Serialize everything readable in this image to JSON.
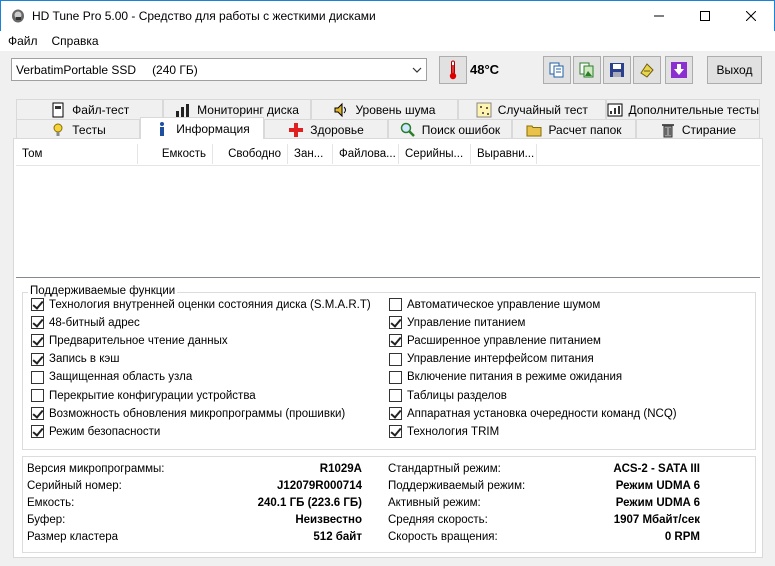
{
  "window": {
    "title": "HD Tune Pro 5.00 - Средство для работы с жесткими дисками"
  },
  "menu": {
    "items": [
      "Файл",
      "Справка"
    ]
  },
  "toolbar": {
    "drive_name": "VerbatimPortable SSD",
    "drive_size": "(240 ГБ)",
    "temperature": "48°C",
    "exit_label": "Выход",
    "icons": [
      "thermometer-icon",
      "copy-text-icon",
      "copy-image-icon",
      "save-icon",
      "options-icon",
      "download-icon"
    ]
  },
  "tabs": {
    "row1": [
      {
        "label": "Файл-тест",
        "icon": "file-test-icon"
      },
      {
        "label": "Мониторинг диска",
        "icon": "monitor-icon"
      },
      {
        "label": "Уровень шума",
        "icon": "speaker-icon"
      },
      {
        "label": "Случайный тест",
        "icon": "random-icon"
      },
      {
        "label": "Дополнительные тесты",
        "icon": "extra-tests-icon"
      }
    ],
    "row2": [
      {
        "label": "Тесты",
        "icon": "benchmark-icon"
      },
      {
        "label": "Информация",
        "icon": "info-icon",
        "active": true
      },
      {
        "label": "Здоровье",
        "icon": "health-icon"
      },
      {
        "label": "Поиск ошибок",
        "icon": "error-scan-icon"
      },
      {
        "label": "Расчет папок",
        "icon": "folder-icon"
      },
      {
        "label": "Стирание",
        "icon": "erase-icon"
      }
    ]
  },
  "volumes": {
    "columns": [
      "Том",
      "Емкость",
      "Свободно",
      "Зан...",
      "Файлова...",
      "Серийны...",
      "Выравни..."
    ]
  },
  "features": {
    "title": "Поддерживаемые функции",
    "left": [
      {
        "label": "Технология внутренней оценки состояния диска (S.M.A.R.T)",
        "checked": true
      },
      {
        "label": "48-битный адрес",
        "checked": true
      },
      {
        "label": "Предварительное чтение данных",
        "checked": true
      },
      {
        "label": "Запись в кэш",
        "checked": true
      },
      {
        "label": "Защищенная область узла",
        "checked": false
      },
      {
        "label": "Перекрытие конфигурации устройства",
        "checked": false
      },
      {
        "label": "Возможность обновления микропрограммы (прошивки)",
        "checked": true
      },
      {
        "label": "Режим безопасности",
        "checked": true
      }
    ],
    "right": [
      {
        "label": "Автоматическое управление шумом",
        "checked": false
      },
      {
        "label": "Управление питанием",
        "checked": true
      },
      {
        "label": "Расширенное управление питанием",
        "checked": true
      },
      {
        "label": "Управление интерфейсом питания",
        "checked": false
      },
      {
        "label": "Включение питания в режиме ожидания",
        "checked": false
      },
      {
        "label": "Таблицы разделов",
        "checked": false
      },
      {
        "label": "Аппаратная установка очередности команд (NCQ)",
        "checked": true
      },
      {
        "label": "Технология TRIM",
        "checked": true
      }
    ]
  },
  "info": {
    "left": [
      {
        "label": "Версия микропрограммы:",
        "value": "R1029A"
      },
      {
        "label": "Серийный номер:",
        "value": "J12079R000714"
      },
      {
        "label": "Емкость:",
        "value": "240.1 ГБ (223.6 ГБ)"
      },
      {
        "label": "Буфер:",
        "value": "Неизвестно"
      },
      {
        "label": "Размер кластера",
        "value": "512 байт"
      }
    ],
    "right": [
      {
        "label": "Стандартный режим:",
        "value": "ACS-2 - SATA III"
      },
      {
        "label": "Поддерживаемый режим:",
        "value": "Режим UDMA 6"
      },
      {
        "label": "Активный режим:",
        "value": "Режим UDMA 6"
      },
      {
        "label": "Средняя скорость:",
        "value": "1907 Мбайт/сек"
      },
      {
        "label": "Скорость вращения:",
        "value": "0 RPM"
      }
    ]
  }
}
